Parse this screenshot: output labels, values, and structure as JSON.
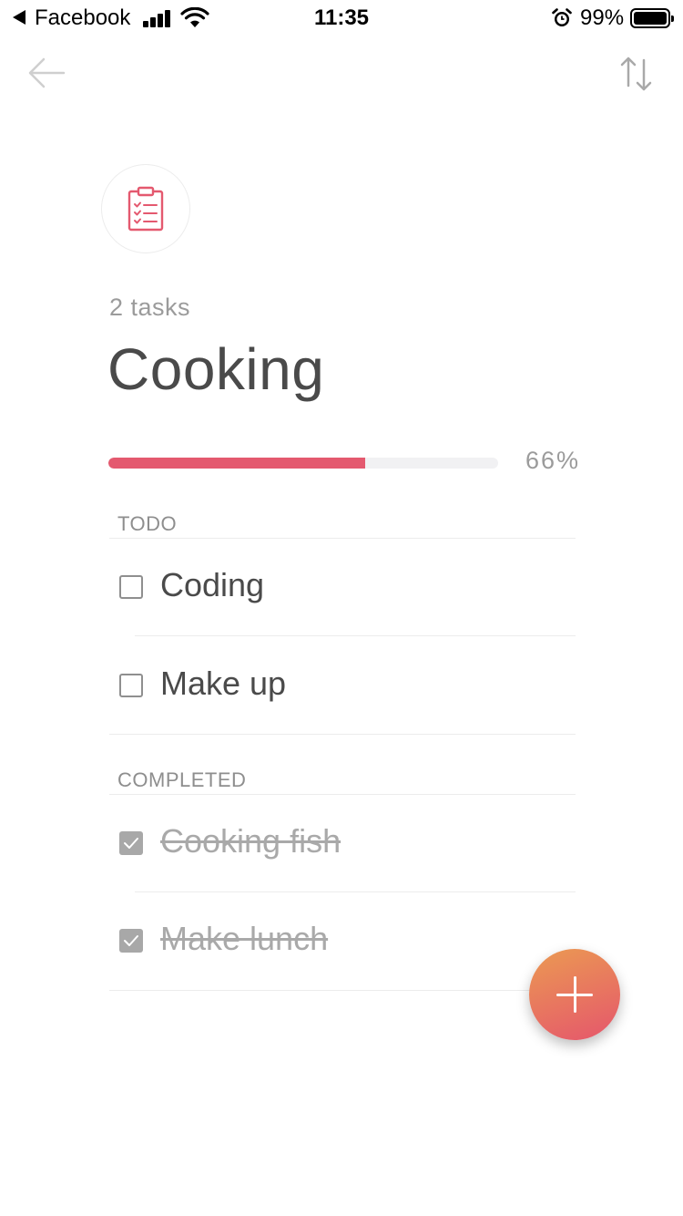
{
  "status_bar": {
    "back_app": "Facebook",
    "time": "11:35",
    "battery_percent": "99%"
  },
  "list": {
    "task_count": "2 tasks",
    "title": "Cooking",
    "progress_percent": 66,
    "progress_label": "66%",
    "icon": "clipboard-checklist-icon"
  },
  "sections": {
    "todo_label": "TODO",
    "completed_label": "COMPLETED"
  },
  "todo_tasks": [
    {
      "label": "Coding",
      "completed": false
    },
    {
      "label": "Make up",
      "completed": false
    }
  ],
  "completed_tasks": [
    {
      "label": "Cooking fish",
      "completed": true
    },
    {
      "label": "Make lunch",
      "completed": true
    }
  ],
  "colors": {
    "accent": "#e4596f",
    "fab_gradient_start": "#eb9a52",
    "fab_gradient_end": "#e5566c"
  }
}
